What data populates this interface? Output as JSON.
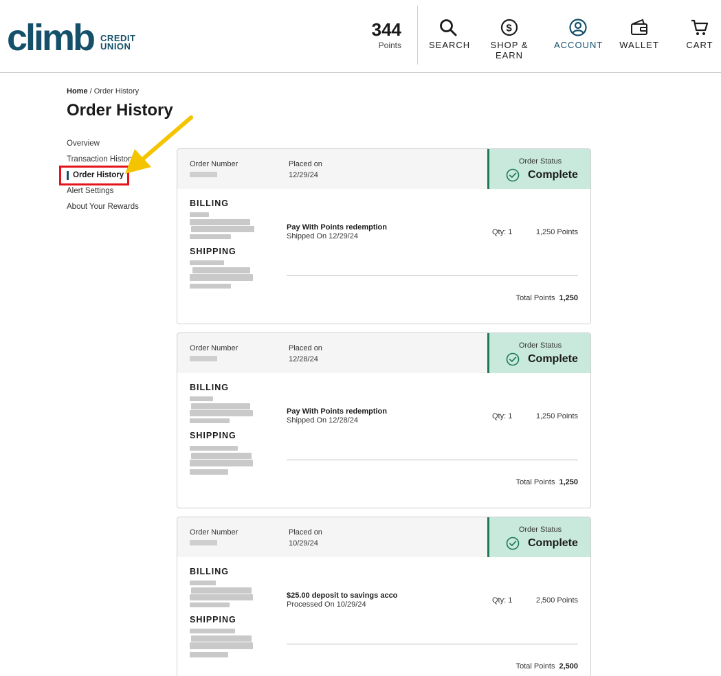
{
  "header": {
    "logo_word": "climb",
    "logo_sub_line1": "CREDIT",
    "logo_sub_line2": "UNION",
    "points_value": "344",
    "points_label": "Points",
    "nav": [
      {
        "label": "SEARCH",
        "icon": "search-icon"
      },
      {
        "label": "SHOP &",
        "label2": "EARN",
        "icon": "dollar-circle-icon"
      },
      {
        "label": "ACCOUNT",
        "icon": "user-circle-icon",
        "active": true
      },
      {
        "label": "WALLET",
        "icon": "wallet-icon"
      },
      {
        "label": "CART",
        "icon": "cart-icon"
      }
    ]
  },
  "breadcrumb": {
    "home": "Home",
    "separator": " / ",
    "current": "Order History"
  },
  "page_title": "Order History",
  "side_nav": {
    "items": [
      {
        "label": "Overview"
      },
      {
        "label": "Transaction History"
      },
      {
        "label": "Order History",
        "active": true
      },
      {
        "label": "Alert Settings"
      },
      {
        "label": "About Your Rewards"
      }
    ]
  },
  "labels": {
    "order_number": "Order Number",
    "placed_on": "Placed on",
    "order_status": "Order Status",
    "billing": "BILLING",
    "shipping": "SHIPPING",
    "total_points": "Total Points"
  },
  "orders": [
    {
      "placed_on": "12/29/24",
      "status": "Complete",
      "item_name": "Pay With Points redemption",
      "item_sub": "Shipped On 12/29/24",
      "qty": "Qty: 1",
      "points": "1,250 Points",
      "total": "1,250"
    },
    {
      "placed_on": "12/28/24",
      "status": "Complete",
      "item_name": "Pay With Points redemption",
      "item_sub": "Shipped On 12/28/24",
      "qty": "Qty: 1",
      "points": "1,250 Points",
      "total": "1,250"
    },
    {
      "placed_on": "10/29/24",
      "status": "Complete",
      "item_name": "$25.00 deposit to savings acco",
      "item_sub": "Processed On 10/29/24",
      "qty": "Qty: 1",
      "points": "2,500 Points",
      "total": "2,500"
    }
  ],
  "colors": {
    "brand": "#14506a",
    "status_bg": "#c9e9dc",
    "status_accent": "#1d7a55",
    "highlight": "#e4131b",
    "arrow": "#f5c400"
  }
}
